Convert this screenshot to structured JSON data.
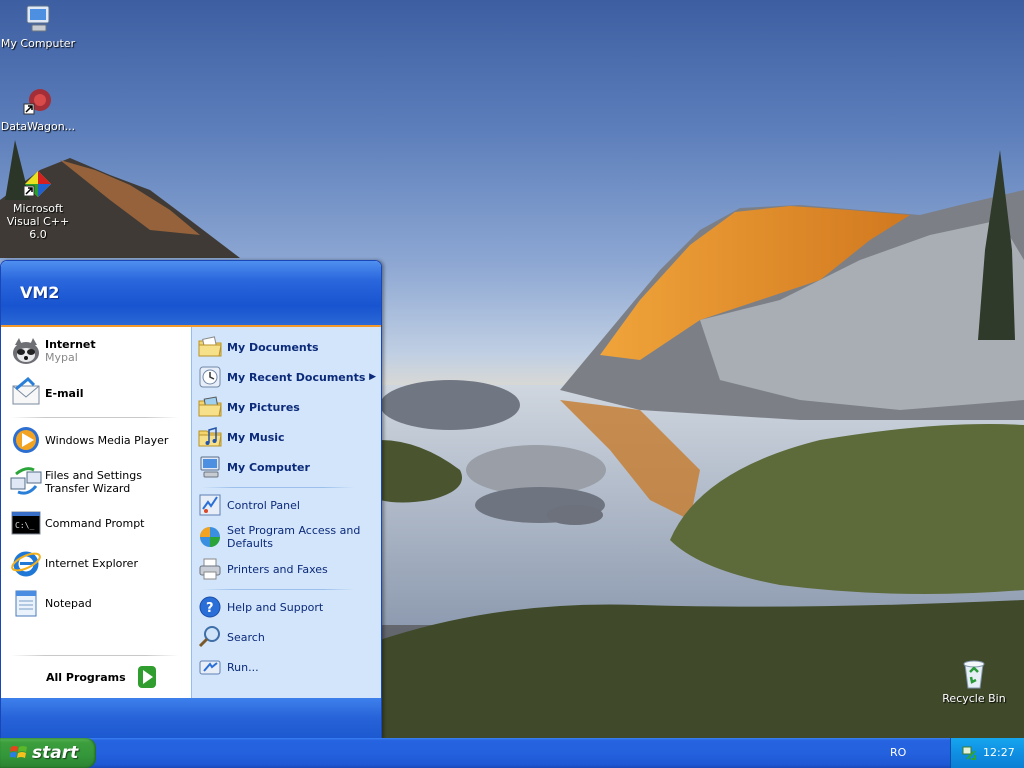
{
  "desktop": {
    "icons": [
      {
        "label": "My Computer",
        "icon": "my-computer-icon"
      },
      {
        "label": "DataWagon...",
        "icon": "datawagon-icon"
      },
      {
        "label": "Microsoft Visual C++ 6.0",
        "icon": "visual-cpp-icon"
      },
      {
        "label": "Recycle Bin",
        "icon": "recycle-bin-icon"
      }
    ]
  },
  "start_menu": {
    "user_name": "VM2",
    "pinned": [
      {
        "label": "Internet",
        "sublabel": "Mypal",
        "icon": "mypal-browser-icon"
      },
      {
        "label": "E-mail",
        "icon": "email-icon"
      }
    ],
    "recent": [
      {
        "label": "Windows Media Player",
        "icon": "media-player-icon"
      },
      {
        "label": "Files and Settings Transfer Wizard",
        "icon": "transfer-wizard-icon"
      },
      {
        "label": "Command Prompt",
        "icon": "command-prompt-icon"
      },
      {
        "label": "Internet Explorer",
        "icon": "internet-explorer-icon"
      },
      {
        "label": "Notepad",
        "icon": "notepad-icon"
      }
    ],
    "all_programs": "All Programs",
    "places": [
      {
        "label": "My Documents",
        "icon": "folder-documents-icon"
      },
      {
        "label": "My Recent Documents",
        "icon": "recent-documents-icon"
      },
      {
        "label": "My Pictures",
        "icon": "folder-pictures-icon"
      },
      {
        "label": "My Music",
        "icon": "folder-music-icon"
      },
      {
        "label": "My Computer",
        "icon": "computer-icon"
      }
    ],
    "settings": [
      {
        "label": "Control Panel",
        "icon": "control-panel-icon"
      },
      {
        "label": "Set Program Access and Defaults",
        "icon": "program-defaults-icon"
      },
      {
        "label": "Printers and Faxes",
        "icon": "printer-icon"
      }
    ],
    "tools": [
      {
        "label": "Help and Support",
        "icon": "help-icon"
      },
      {
        "label": "Search",
        "icon": "search-icon"
      },
      {
        "label": "Run...",
        "icon": "run-icon"
      }
    ]
  },
  "taskbar": {
    "start_label": "start",
    "language": "RO",
    "clock": "12:27"
  },
  "colors": {
    "start_menu_header": "#2a66dc",
    "start_menu_right_pane": "#d3e5fa",
    "taskbar": "#2461de",
    "start_button": "#3c9e3c",
    "system_tray": "#0f8fe3",
    "menu_accent_orange": "#f49a2a"
  }
}
